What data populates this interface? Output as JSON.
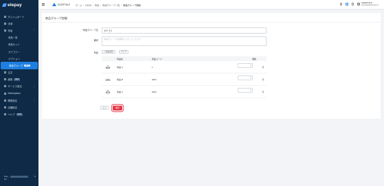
{
  "app": {
    "logo": "elepay",
    "shop_name": "SLEEPTALE"
  },
  "sidebar": {
    "items": [
      {
        "label": "ダッシュボード",
        "icon": "dashboard-icon"
      },
      {
        "label": "決済",
        "icon": "payment-icon"
      },
      {
        "label": "商品",
        "icon": "product-icon"
      },
      {
        "label": "商品一覧"
      },
      {
        "label": "商品セット"
      },
      {
        "label": "カテゴリー"
      },
      {
        "label": "オプション"
      },
      {
        "label": "商品グループ",
        "badge": "NEW"
      },
      {
        "label": "注文",
        "icon": "order-icon"
      },
      {
        "label": "顧客",
        "icon": "customer-icon",
        "badge": "NEW"
      },
      {
        "label": "サービス設定",
        "icon": "service-icon"
      },
      {
        "label": "Marketplace",
        "icon": "marketplace-icon"
      },
      {
        "label": "開発設定",
        "icon": "developer-icon"
      },
      {
        "label": "店舗設定",
        "icon": "store-icon"
      },
      {
        "label": "ヘルプ",
        "icon": "help-icon",
        "badge": "NEW"
      }
    ],
    "footer": {
      "line1": "Beta",
      "line2": "EN"
    }
  },
  "breadcrumb": [
    "ホーム",
    "DASH",
    "商品",
    "商品グループ一覧",
    "商品グループ詳細"
  ],
  "user": {
    "name": "SLEEPTALE",
    "email": "sleeptale@elepay.io"
  },
  "page": {
    "title": "商品グループ詳細",
    "labels": {
      "group_name": "商品グループ名",
      "note": "備考",
      "products": "商品"
    },
    "group_name_value": "カテゴリ",
    "note_placeholder": "商品グループの説明を入力してください",
    "add_product_button": "+ 商品追加",
    "clear_button": "クリア",
    "table": {
      "headers": [
        "商品名",
        "商品コード",
        "価格"
      ],
      "rows": [
        {
          "name": "商品 A",
          "code": "1",
          "price": ""
        },
        {
          "name": "商品 B",
          "code": "0004",
          "price": ""
        },
        {
          "name": "商品 C",
          "code": "0002",
          "price": ""
        }
      ]
    },
    "back_button": "戻る",
    "save_button": "保存"
  },
  "colors": {
    "sidebar_bg": "#0e2a47",
    "accent": "#1f7fe0",
    "danger": "#e33a4b"
  }
}
